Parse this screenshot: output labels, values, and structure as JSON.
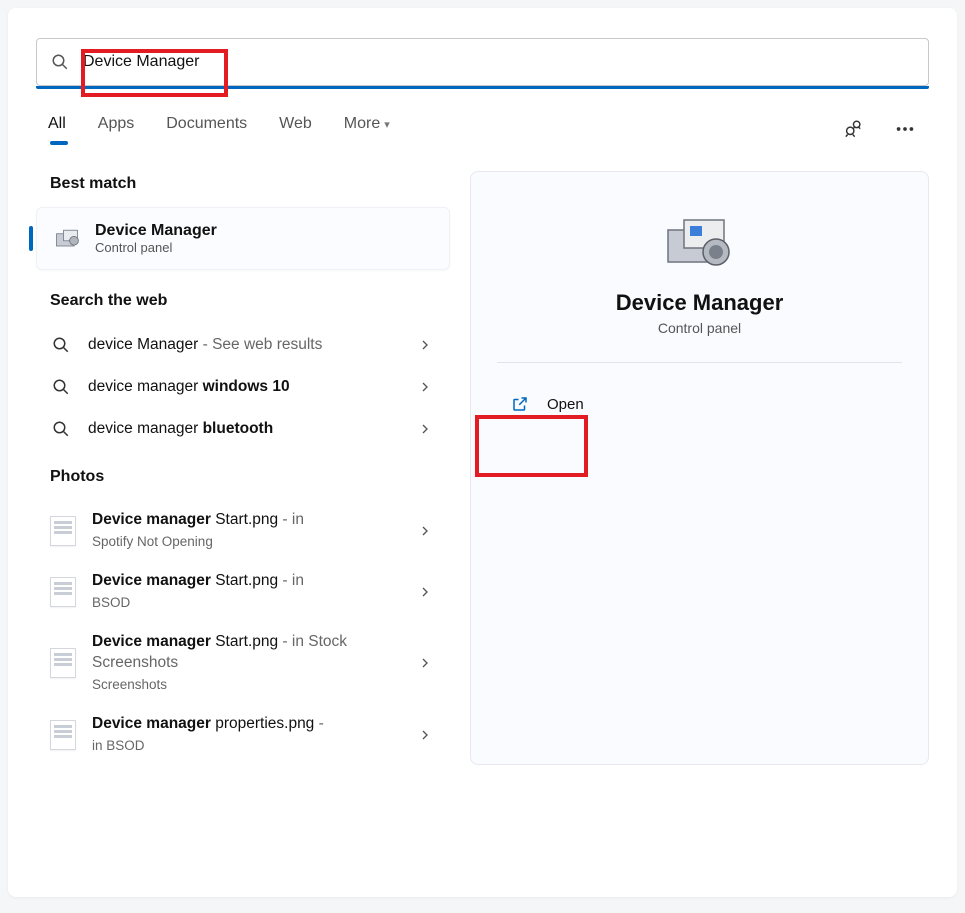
{
  "search": {
    "query": "Device Manager"
  },
  "tabs": [
    "All",
    "Apps",
    "Documents",
    "Web",
    "More"
  ],
  "sections": {
    "best": "Best match",
    "web": "Search the web",
    "photos": "Photos"
  },
  "bestMatch": {
    "title": "Device Manager",
    "subtitle": "Control panel"
  },
  "webResults": [
    {
      "prefix": "device Manager",
      "suffix": " - See web results"
    },
    {
      "prefix": "device manager ",
      "bold": "windows 10"
    },
    {
      "prefix": "device manager ",
      "bold": "bluetooth"
    }
  ],
  "photoResults": [
    {
      "boldPrefix": "Device manager",
      "rest": " Start.png",
      "location": "Spotify Not Opening"
    },
    {
      "boldPrefix": "Device manager",
      "rest": " Start.png",
      "location": "BSOD"
    },
    {
      "boldPrefix": "Device manager",
      "rest": " Start.png",
      "location": "Stock Screenshots"
    },
    {
      "boldPrefix": "Device manager",
      "rest": " properties.png",
      "location": "BSOD"
    }
  ],
  "preview": {
    "title": "Device Manager",
    "subtitle": "Control panel",
    "openLabel": "Open"
  }
}
